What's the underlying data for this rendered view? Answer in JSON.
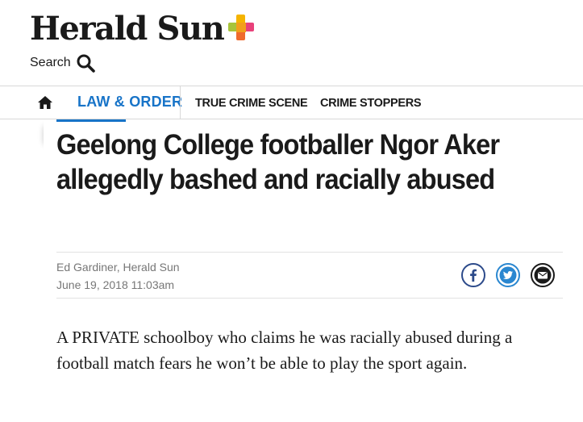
{
  "masthead": {
    "logo_text": "Herald Sun",
    "logo_plus_colors": [
      "#f5b400",
      "#a8c43a",
      "#f29f1b",
      "#e8417a",
      "#ef6a2d"
    ],
    "search_label": "Search",
    "search_icon": "search-icon"
  },
  "nav": {
    "home_icon": "home-icon",
    "items": [
      {
        "label": "LAW & ORDER",
        "active": true
      },
      {
        "label": "TRUE CRIME SCENE",
        "active": false
      },
      {
        "label": "CRIME STOPPERS",
        "active": false
      }
    ],
    "active_color": "#1874c8"
  },
  "article": {
    "headline": "Geelong College footballer Ngor Aker allegedly bashed and racially abused",
    "author": "Ed Gardiner, Herald Sun",
    "date": "June 19, 2018 11:03am",
    "share": {
      "facebook_icon": "facebook-icon",
      "twitter_icon": "twitter-icon",
      "email_icon": "email-icon",
      "facebook_color": "#2c4a8a",
      "twitter_color": "#2a87d0",
      "email_color": "#1a1a1a"
    },
    "body": "A PRIVATE schoolboy who claims he was racially abused during a football match fears he won’t be able to play the sport again."
  }
}
